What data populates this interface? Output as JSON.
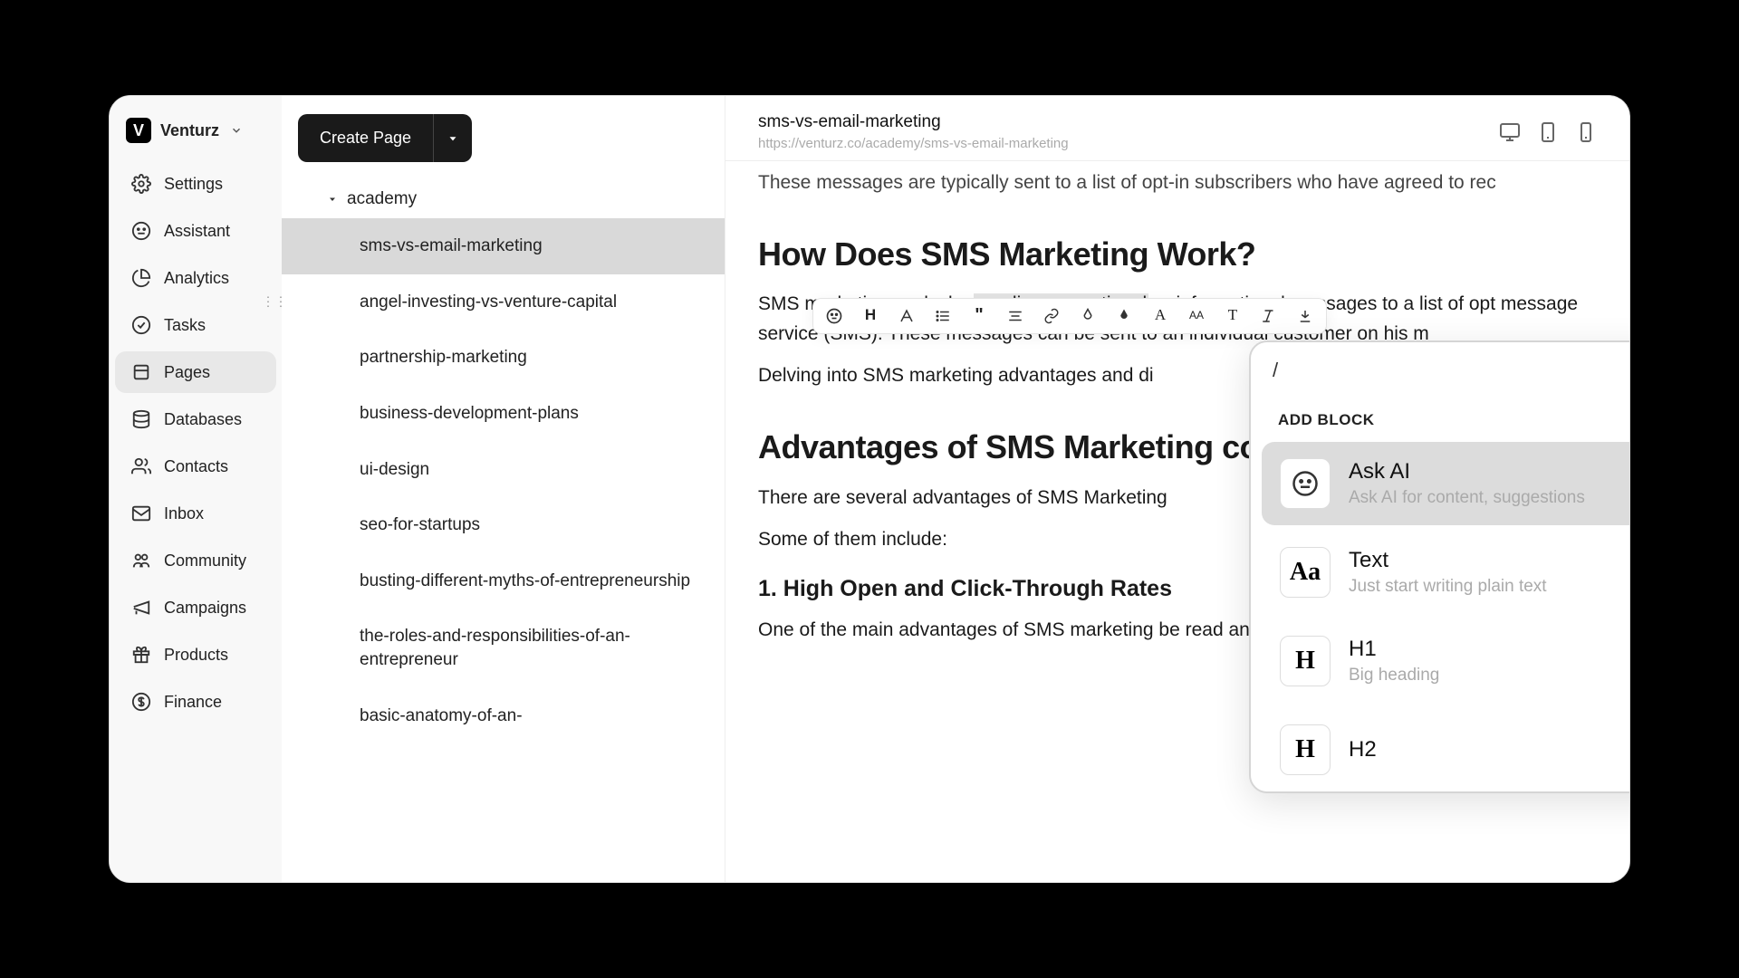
{
  "brand": {
    "logo": "V",
    "name": "Venturz"
  },
  "nav": {
    "items": [
      {
        "label": "Settings"
      },
      {
        "label": "Assistant"
      },
      {
        "label": "Analytics"
      },
      {
        "label": "Tasks"
      },
      {
        "label": "Pages"
      },
      {
        "label": "Databases"
      },
      {
        "label": "Contacts"
      },
      {
        "label": "Inbox"
      },
      {
        "label": "Community"
      },
      {
        "label": "Campaigns"
      },
      {
        "label": "Products"
      },
      {
        "label": "Finance"
      }
    ],
    "active_index": 4
  },
  "create_button": "Create Page",
  "tree": {
    "parent": "academy",
    "items": [
      "sms-vs-email-marketing",
      "angel-investing-vs-venture-capital",
      "partnership-marketing",
      "business-development-plans",
      "ui-design",
      "seo-for-startups",
      "busting-different-myths-of-entrepreneurship",
      "the-roles-and-responsibilities-of-an-entrepreneur",
      "basic-anatomy-of-an-"
    ],
    "selected_index": 0
  },
  "page": {
    "title": "sms-vs-email-marketing",
    "url": "https://venturz.co/academy/sms-vs-email-marketing"
  },
  "content": {
    "clip_top": "These messages are typically sent to a list of opt-in subscribers who have agreed to rec",
    "heading1": "How Does SMS Marketing Work?",
    "para1_pre": "SMS marketing works by ",
    "para1_hl": "sending promotional",
    "para1_post": " or informational messages to a list of opt message service (SMS). These messages can be sent to an individual customer on his m",
    "para2": "Delving into SMS marketing advantages and di                                                                                                              them.",
    "heading2": "Advantages of SMS Marketing co",
    "para3": "There are several advantages of SMS Marketing",
    "para4": "Some of them include:",
    "sub1": "1. High Open and Click-Through Rates",
    "para5": "One of the main advantages of SMS marketing be read and interacted with almost immediatel"
  },
  "add_block": {
    "label": "ADD BLOCK",
    "items": [
      {
        "icon": "face",
        "title": "Ask AI",
        "subtitle": "Ask AI for content, suggestions"
      },
      {
        "icon": "Aa",
        "title": "Text",
        "subtitle": "Just start writing plain text"
      },
      {
        "icon": "H",
        "title": "H1",
        "subtitle": "Big heading"
      },
      {
        "icon": "H",
        "title": "H2",
        "subtitle": ""
      }
    ],
    "selected_index": 0
  }
}
